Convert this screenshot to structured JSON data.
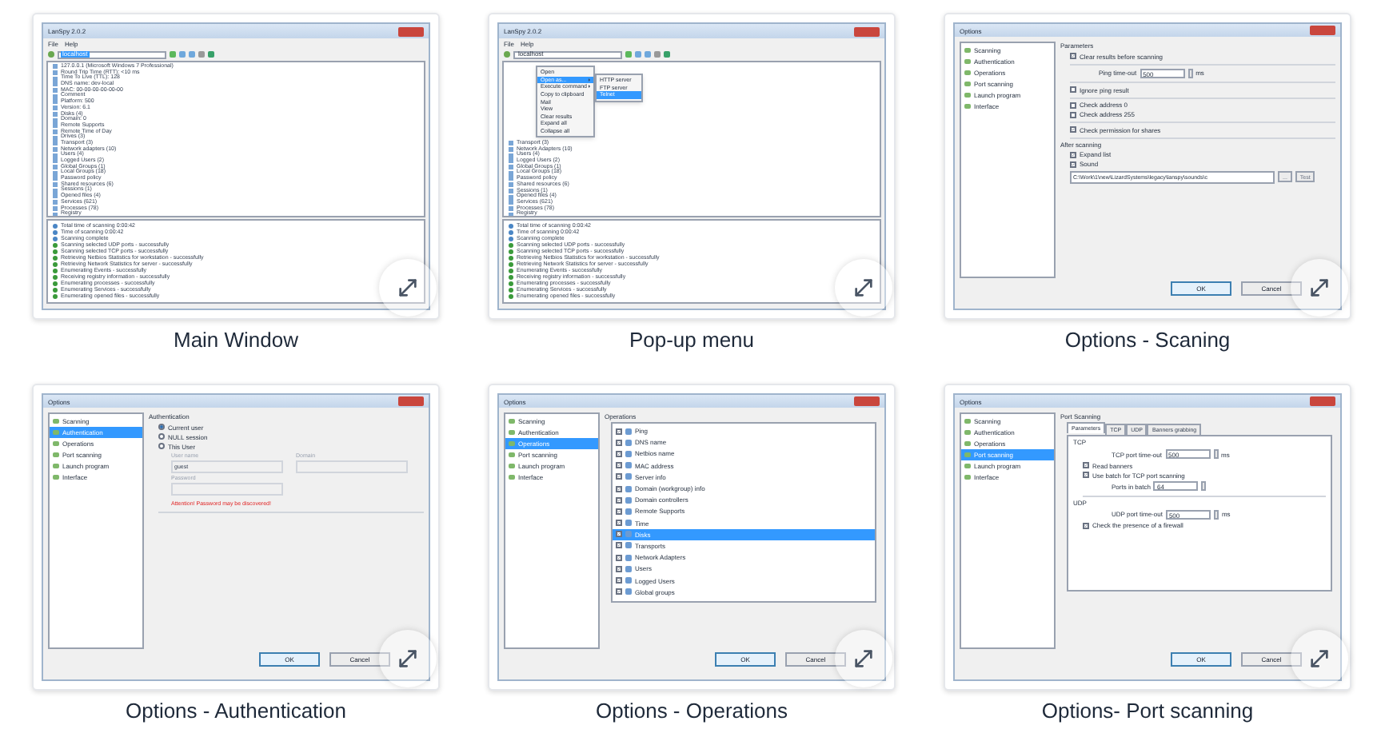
{
  "cards": [
    {
      "caption": "Main Window",
      "screen": {
        "kind": "main",
        "title": "LanSpy 2.0.2",
        "menu": [
          "File",
          "Help"
        ],
        "address": "localhost",
        "address_selected": true,
        "tree": [
          {
            "label": "127.0.0.1 (Microsoft Windows 7 Professional)",
            "selected": false
          },
          {
            "label": "Round Trip Time (RTT): <10 ms",
            "selected": false
          },
          {
            "label": "Time To Live (TTL): 128",
            "selected": false
          },
          {
            "label": "DNS name: dev-local",
            "selected": false
          },
          {
            "label": "MAC: 00-00-00-00-00-00",
            "selected": false
          },
          {
            "label": "Comment",
            "selected": false
          },
          {
            "label": "Platform: 500",
            "selected": false
          },
          {
            "label": "Version: 6.1",
            "selected": false
          },
          {
            "label": "Disks (4)",
            "selected": false
          },
          {
            "label": "Domain: 0",
            "selected": false
          },
          {
            "label": "Remote Supports",
            "selected": false
          },
          {
            "label": "Remote Time of Day",
            "selected": false
          },
          {
            "label": "Drives (3)",
            "selected": false
          },
          {
            "label": "Transport (3)",
            "selected": false
          },
          {
            "label": "Network adapters (10)",
            "selected": false
          },
          {
            "label": "Users (4)",
            "selected": false
          },
          {
            "label": "Logged Users (2)",
            "selected": false
          },
          {
            "label": "Global Groups (1)",
            "selected": false
          },
          {
            "label": "Local Groups (18)",
            "selected": false
          },
          {
            "label": "Password policy",
            "selected": false
          },
          {
            "label": "Shared resources (6)",
            "selected": false
          },
          {
            "label": "Sessions (1)",
            "selected": false
          },
          {
            "label": "Opened files (4)",
            "selected": false
          },
          {
            "label": "Services (621)",
            "selected": false
          },
          {
            "label": "Processes (78)",
            "selected": false
          },
          {
            "label": "Registry",
            "selected": false
          }
        ],
        "log": [
          {
            "kind": "info",
            "text": "Total time of scanning 0:00:42"
          },
          {
            "kind": "info",
            "text": "Time of scanning 0:00:42"
          },
          {
            "kind": "info",
            "text": "Scanning complete"
          },
          {
            "kind": "success",
            "text": "Scanning selected UDP ports - successfully"
          },
          {
            "kind": "success",
            "text": "Scanning selected TCP ports - successfully"
          },
          {
            "kind": "success",
            "text": "Retrieving Netbios Statistics for workstation - successfully"
          },
          {
            "kind": "success",
            "text": "Retrieving Network Statistics for server - successfully"
          },
          {
            "kind": "success",
            "text": "Enumerating Events - successfully"
          },
          {
            "kind": "success",
            "text": "Receiving registry information - successfully"
          },
          {
            "kind": "success",
            "text": "Enumerating processes - successfully"
          },
          {
            "kind": "success",
            "text": "Enumerating Services - successfully"
          },
          {
            "kind": "success",
            "text": "Enumerating opened files - successfully"
          }
        ]
      }
    },
    {
      "caption": "Pop-up menu",
      "screen": {
        "kind": "main",
        "title": "LanSpy 2.0.2",
        "menu": [
          "File",
          "Help"
        ],
        "address": "localhost",
        "address_selected": false,
        "popup": {
          "items": [
            {
              "label": "Open",
              "submenu": false,
              "selected": false
            },
            {
              "label": "Open as...",
              "submenu": true,
              "selected": true
            },
            {
              "label": "Execute command",
              "submenu": true,
              "selected": false
            },
            {
              "label": "Copy to clipboard",
              "submenu": false,
              "selected": false
            },
            {
              "label": "Mail",
              "submenu": false,
              "selected": false
            },
            {
              "label": "View",
              "submenu": false,
              "selected": false
            },
            {
              "label": "Clear results",
              "submenu": false,
              "selected": false
            },
            {
              "label": "Expand all",
              "submenu": false,
              "selected": false
            },
            {
              "label": "Collapse all",
              "submenu": false,
              "selected": false
            }
          ],
          "submenu": [
            {
              "label": "HTTP server",
              "selected": false
            },
            {
              "label": "FTP server",
              "selected": false
            },
            {
              "label": "Telnet",
              "selected": true
            }
          ]
        },
        "tree": [
          {
            "label": "Transport (3)",
            "selected": false
          },
          {
            "label": "Network Adapters (10)",
            "selected": false
          },
          {
            "label": "Users (4)",
            "selected": false
          },
          {
            "label": "Logged Users (2)",
            "selected": false
          },
          {
            "label": "Global Groups (1)",
            "selected": false
          },
          {
            "label": "Local Groups (18)",
            "selected": false
          },
          {
            "label": "Password policy",
            "selected": false
          },
          {
            "label": "Shared resources (6)",
            "selected": false
          },
          {
            "label": "Sessions (1)",
            "selected": false
          },
          {
            "label": "Opened files (4)",
            "selected": false
          },
          {
            "label": "Services (621)",
            "selected": false
          },
          {
            "label": "Processes (78)",
            "selected": false
          },
          {
            "label": "Registry",
            "selected": false
          }
        ],
        "log": [
          {
            "kind": "info",
            "text": "Total time of scanning 0:00:42"
          },
          {
            "kind": "info",
            "text": "Time of scanning 0:00:42"
          },
          {
            "kind": "info",
            "text": "Scanning complete"
          },
          {
            "kind": "success",
            "text": "Scanning selected UDP ports - successfully"
          },
          {
            "kind": "success",
            "text": "Scanning selected TCP ports - successfully"
          },
          {
            "kind": "success",
            "text": "Retrieving Netbios Statistics for workstation - successfully"
          },
          {
            "kind": "success",
            "text": "Retrieving Network Statistics for server - successfully"
          },
          {
            "kind": "success",
            "text": "Enumerating Events - successfully"
          },
          {
            "kind": "success",
            "text": "Receiving registry information - successfully"
          },
          {
            "kind": "success",
            "text": "Enumerating processes - successfully"
          },
          {
            "kind": "success",
            "text": "Enumerating Services - successfully"
          },
          {
            "kind": "success",
            "text": "Enumerating opened files - successfully"
          }
        ]
      }
    },
    {
      "caption": "Options - Scaning",
      "screen": {
        "kind": "options",
        "title": "Options",
        "nav": [
          {
            "label": "Scanning",
            "selected": false
          },
          {
            "label": "Authentication",
            "selected": false
          },
          {
            "label": "Operations",
            "selected": false
          },
          {
            "label": "Port scanning",
            "selected": false
          },
          {
            "label": "Launch program",
            "selected": false
          },
          {
            "label": "Interface",
            "selected": false
          }
        ],
        "pane": [
          {
            "kind": "group",
            "label": "Parameters"
          },
          {
            "kind": "check",
            "label": "Clear results before scanning",
            "checked": true
          },
          {
            "kind": "divider"
          },
          {
            "kind": "spin",
            "label": "Ping time-out",
            "value": "500",
            "unit": "ms"
          },
          {
            "kind": "divider"
          },
          {
            "kind": "check",
            "label": "Ignore ping result",
            "checked": false
          },
          {
            "kind": "divider"
          },
          {
            "kind": "check",
            "label": "Check address 0",
            "checked": false
          },
          {
            "kind": "check",
            "label": "Check address 255",
            "checked": false
          },
          {
            "kind": "divider"
          },
          {
            "kind": "check",
            "label": "Check permission for shares",
            "checked": true
          },
          {
            "kind": "divider"
          },
          {
            "kind": "group",
            "label": "After scanning"
          },
          {
            "kind": "check",
            "label": "Expand list",
            "checked": true
          },
          {
            "kind": "check",
            "label": "Sound",
            "checked": true
          },
          {
            "kind": "path",
            "value": "C:\\Work\\1\\new\\LizardSystems\\legacy\\lanspy\\sounds\\c",
            "buttons": [
              "...",
              "Test"
            ]
          }
        ],
        "buttons": [
          "OK",
          "Cancel"
        ]
      }
    },
    {
      "caption": "Options - Authentication",
      "screen": {
        "kind": "options",
        "title": "Options",
        "nav": [
          {
            "label": "Scanning",
            "selected": false
          },
          {
            "label": "Authentication",
            "selected": true
          },
          {
            "label": "Operations",
            "selected": false
          },
          {
            "label": "Port scanning",
            "selected": false
          },
          {
            "label": "Launch program",
            "selected": false
          },
          {
            "label": "Interface",
            "selected": false
          }
        ],
        "pane": [
          {
            "kind": "group",
            "label": "Authentication"
          },
          {
            "kind": "radio",
            "label": "Current user",
            "selected": true
          },
          {
            "kind": "radio",
            "label": "NULL session",
            "selected": false
          },
          {
            "kind": "radio",
            "label": "This User",
            "selected": false
          },
          {
            "kind": "fields",
            "fields": [
              {
                "label": "User name",
                "value": "guest"
              },
              {
                "label": "Domain"
              }
            ]
          },
          {
            "kind": "fields",
            "fields": [
              {
                "label": "Password"
              }
            ]
          },
          {
            "kind": "warning",
            "text": "Attention! Password may be discovered!"
          },
          {
            "kind": "divider"
          }
        ],
        "buttons": [
          "OK",
          "Cancel"
        ]
      }
    },
    {
      "caption": "Options - Operations",
      "screen": {
        "kind": "options",
        "title": "Options",
        "nav": [
          {
            "label": "Scanning",
            "selected": false
          },
          {
            "label": "Authentication",
            "selected": false
          },
          {
            "label": "Operations",
            "selected": true
          },
          {
            "label": "Port scanning",
            "selected": false
          },
          {
            "label": "Launch program",
            "selected": false
          },
          {
            "label": "Interface",
            "selected": false
          }
        ],
        "pane": [
          {
            "kind": "group",
            "label": "Operations"
          },
          {
            "kind": "list",
            "items": [
              {
                "label": "Ping",
                "checked": true,
                "selected": false
              },
              {
                "label": "DNS name",
                "checked": true,
                "selected": false
              },
              {
                "label": "Netbios name",
                "checked": true,
                "selected": false
              },
              {
                "label": "MAC address",
                "checked": true,
                "selected": false
              },
              {
                "label": "Server info",
                "checked": true,
                "selected": false
              },
              {
                "label": "Domain (workgroup) info",
                "checked": true,
                "selected": false
              },
              {
                "label": "Domain controllers",
                "checked": true,
                "selected": false
              },
              {
                "label": "Remote Supports",
                "checked": true,
                "selected": false
              },
              {
                "label": "Time",
                "checked": true,
                "selected": false
              },
              {
                "label": "Disks",
                "checked": true,
                "selected": true
              },
              {
                "label": "Transports",
                "checked": true,
                "selected": false
              },
              {
                "label": "Network Adapters",
                "checked": true,
                "selected": false
              },
              {
                "label": "Users",
                "checked": true,
                "selected": false
              },
              {
                "label": "Logged Users",
                "checked": true,
                "selected": false
              },
              {
                "label": "Global groups",
                "checked": true,
                "selected": false
              }
            ]
          }
        ],
        "buttons": [
          "OK",
          "Cancel"
        ]
      }
    },
    {
      "caption": "Options- Port scanning",
      "screen": {
        "kind": "options",
        "title": "Options",
        "nav": [
          {
            "label": "Scanning",
            "selected": false
          },
          {
            "label": "Authentication",
            "selected": false
          },
          {
            "label": "Operations",
            "selected": false
          },
          {
            "label": "Port scanning",
            "selected": true
          },
          {
            "label": "Launch program",
            "selected": false
          },
          {
            "label": "Interface",
            "selected": false
          }
        ],
        "pane": [
          {
            "kind": "group",
            "label": "Port Scanning"
          },
          {
            "kind": "tabs",
            "tabs": [
              {
                "label": "Parameters",
                "selected": true
              },
              {
                "label": "TCP",
                "selected": false
              },
              {
                "label": "UDP",
                "selected": false
              },
              {
                "label": "Banners grabbing",
                "selected": false
              }
            ],
            "rows": [
              {
                "kind": "group",
                "label": "TCP"
              },
              {
                "kind": "spin",
                "label": "TCP port time-out",
                "value": "500",
                "unit": "ms"
              },
              {
                "kind": "check",
                "label": "Read banners",
                "checked": true
              },
              {
                "kind": "check",
                "label": "Use batch for TCP port scanning",
                "checked": true
              },
              {
                "kind": "spin",
                "label": "Ports in batch",
                "value": "64"
              },
              {
                "kind": "divider"
              },
              {
                "kind": "group",
                "label": "UDP"
              },
              {
                "kind": "spin",
                "label": "UDP port time-out",
                "value": "500",
                "unit": "ms"
              },
              {
                "kind": "check",
                "label": "Check the presence of a firewall",
                "checked": true
              }
            ]
          }
        ],
        "buttons": [
          "OK",
          "Cancel"
        ]
      }
    }
  ]
}
